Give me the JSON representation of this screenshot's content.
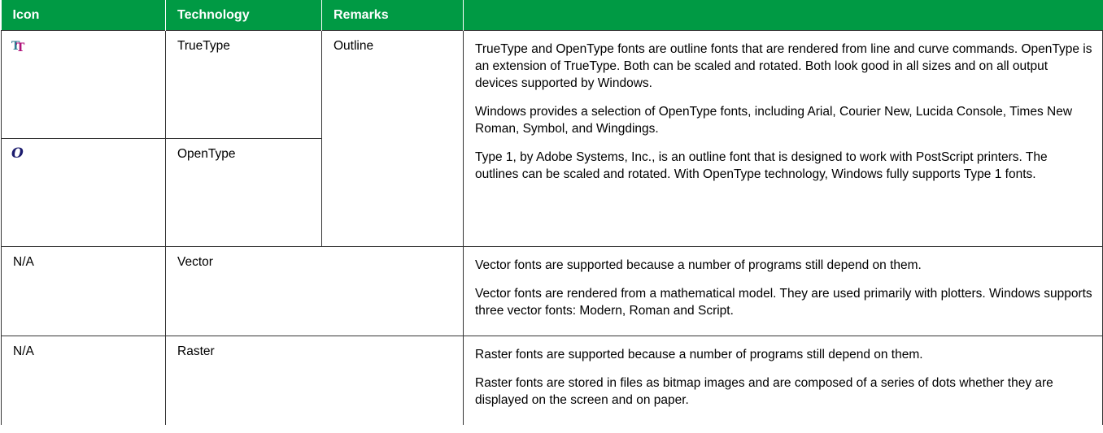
{
  "headers": {
    "icon": "Icon",
    "technology": "Technology",
    "remarks": "Remarks"
  },
  "outline": {
    "truetype_icon": "TT",
    "truetype_tech": "TrueType",
    "opentype_icon": "O",
    "opentype_tech": "OpenType",
    "remarks": "Outline",
    "description": [
      "TrueType and OpenType fonts are outline fonts that are rendered from line and curve commands. OpenType is an extension of TrueType. Both can be scaled and rotated. Both look good in all sizes and on all output devices supported by Windows.",
      "Windows provides a selection of OpenType fonts, including Arial, Courier New, Lucida Console, Times New Roman, Symbol, and Wingdings.",
      "Type 1, by Adobe Systems, Inc., is an outline font that is designed to work with PostScript printers. The outlines can be scaled and rotated. With OpenType technology, Windows fully supports Type 1 fonts."
    ]
  },
  "vector": {
    "icon": "N/A",
    "tech": "Vector",
    "description": [
      "Vector fonts are supported because a number of programs still depend on them.",
      "Vector fonts are rendered from a mathematical model. They are used primarily with plotters. Windows supports three vector fonts: Modern, Roman and Script."
    ]
  },
  "raster": {
    "icon": "N/A",
    "tech": "Raster",
    "description": [
      "Raster fonts are supported because a number of programs still depend on them.",
      "Raster fonts are stored in files as bitmap images and are composed of a series of dots whether they are displayed on the screen and on paper."
    ]
  }
}
